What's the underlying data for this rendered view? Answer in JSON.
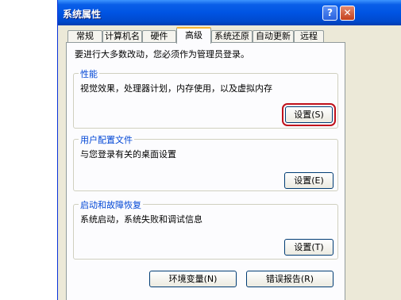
{
  "window": {
    "title": "系统属性"
  },
  "titlebar_buttons": {
    "help": "?",
    "close": "✕"
  },
  "tabs": [
    {
      "label": "常规",
      "active": false
    },
    {
      "label": "计算机名",
      "active": false
    },
    {
      "label": "硬件",
      "active": false
    },
    {
      "label": "高级",
      "active": true
    },
    {
      "label": "系统还原",
      "active": false
    },
    {
      "label": "自动更新",
      "active": false
    },
    {
      "label": "远程",
      "active": false
    }
  ],
  "admin_note": "要进行大多数改动，您必须作为管理员登录。",
  "performance": {
    "title": "性能",
    "desc": "视觉效果，处理器计划，内存使用，以及虚拟内存",
    "button": "设置(S)",
    "highlighted": true
  },
  "user_profiles": {
    "title": "用户配置文件",
    "desc": "与您登录有关的桌面设置",
    "button": "设置(E)"
  },
  "startup_recovery": {
    "title": "启动和故障恢复",
    "desc": "系统启动，系统失败和调试信息",
    "button": "设置(T)"
  },
  "bottom_buttons": {
    "env_vars": "环境变量(N)",
    "error_report": "错误报告(R)"
  },
  "colors": {
    "titlebar": "#0054e3",
    "dialog_bg": "#ece9d8",
    "panel_bg": "#fcfcfe",
    "group_title": "#0046d5",
    "highlight": "#c0111b"
  }
}
